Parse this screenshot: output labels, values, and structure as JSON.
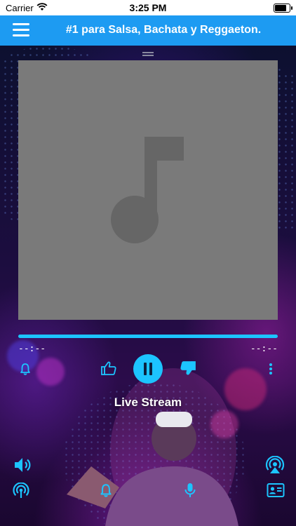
{
  "status_bar": {
    "carrier": "Carrier",
    "time": "3:25 PM",
    "battery_level": 0.9
  },
  "nav": {
    "title": "#1 para Salsa, Bachata y Reggaeton."
  },
  "player": {
    "time_elapsed": "--:--",
    "time_total": "--:--",
    "progress": 1.0,
    "stream_title": "Live Stream",
    "state": "playing"
  },
  "icons": {
    "menu": "hamburger-menu-icon",
    "top_left": "bell-icon",
    "like": "thumbs-up-icon",
    "pause": "pause-icon",
    "dislike": "thumbs-down-icon",
    "more": "more-vertical-icon",
    "volume": "speaker-icon",
    "airplay": "airplay-icon",
    "broadcast": "broadcast-icon",
    "alarm": "bell-icon",
    "mic": "microphone-icon",
    "contact": "contact-card-icon"
  },
  "colors": {
    "accent": "#1cc4ff",
    "nav_bar": "#1d9bf2",
    "album_placeholder": "#7a7a7a"
  }
}
